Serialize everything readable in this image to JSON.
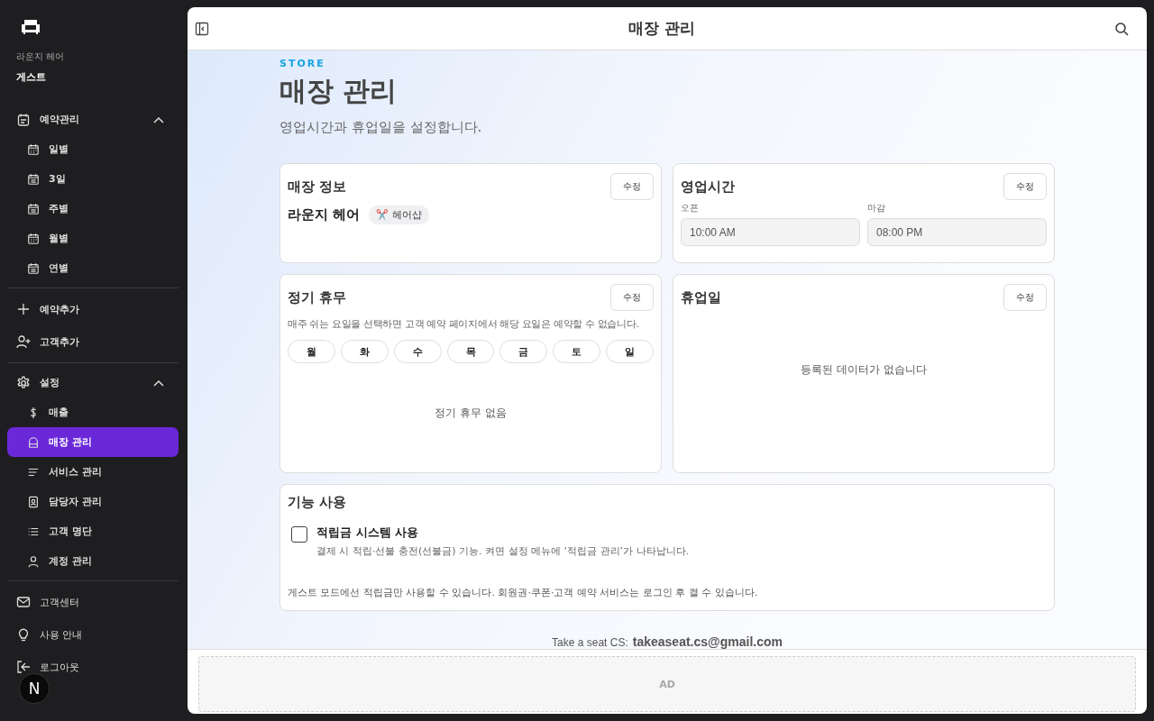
{
  "sidebar": {
    "store_name": "라운지 헤어",
    "user": "게스트",
    "sections": [
      {
        "items": [
          {
            "kind": "group",
            "label": "예약관리",
            "expanded": true,
            "children": [
              {
                "label": "일별",
                "selected": false
              },
              {
                "label": "3일",
                "selected": false
              },
              {
                "label": "주별",
                "selected": false
              },
              {
                "label": "월별",
                "selected": false
              },
              {
                "label": "연별",
                "selected": false
              }
            ]
          }
        ]
      },
      {
        "items": [
          {
            "kind": "link",
            "label": "예약추가"
          },
          {
            "kind": "link",
            "label": "고객추가"
          }
        ]
      },
      {
        "items": [
          {
            "kind": "group",
            "label": "설정",
            "expanded": true,
            "children": [
              {
                "label": "매출",
                "selected": false
              },
              {
                "label": "매장 관리",
                "selected": true
              },
              {
                "label": "서비스 관리",
                "selected": false
              },
              {
                "label": "담당자 관리",
                "selected": false
              },
              {
                "label": "고객 명단",
                "selected": false
              },
              {
                "label": "계정 관리",
                "selected": false
              }
            ]
          }
        ]
      },
      {
        "items": [
          {
            "kind": "link",
            "label": "고객센터"
          },
          {
            "kind": "link",
            "label": "사용 안내"
          },
          {
            "kind": "link",
            "label": "로그아웃"
          }
        ]
      }
    ],
    "badge": "N"
  },
  "header": {
    "title": "매장 관리"
  },
  "page": {
    "eyebrow": "STORE",
    "title": "매장 관리",
    "subtitle": "영업시간과 휴업일을 설정합니다."
  },
  "store_info": {
    "title": "매장 정보",
    "edit": "수정",
    "name": "라운지 헤어",
    "category": "✂️ 헤어샵"
  },
  "hours": {
    "title": "영업시간",
    "edit": "수정",
    "fields": [
      {
        "label": "오픈",
        "value": "10:00 AM"
      },
      {
        "label": "마감",
        "value": "08:00 PM"
      }
    ]
  },
  "regular_closure": {
    "title": "정기 휴무",
    "edit": "수정",
    "description": "매주 쉬는 요일을 선택하면 고객 예약 페이지에서 해당 요일은 예약할 수 없습니다.",
    "days": [
      {
        "label": "월",
        "selected": false
      },
      {
        "label": "화",
        "selected": false
      },
      {
        "label": "수",
        "selected": false
      },
      {
        "label": "목",
        "selected": false
      },
      {
        "label": "금",
        "selected": false
      },
      {
        "label": "토",
        "selected": false
      },
      {
        "label": "일",
        "selected": false
      }
    ],
    "empty": "정기 휴무 없음"
  },
  "holidays": {
    "title": "휴업일",
    "edit": "수정",
    "empty": "등록된 데이터가 없습니다"
  },
  "features": {
    "title": "기능 사용",
    "options": [
      {
        "label": "적립금 시스템 사용",
        "description": "결제 시 적립·선불 충전(선불금) 기능. 켜면 설정 메뉴에 ‘적립금 관리’가 나타납니다.",
        "checked": false
      }
    ],
    "note": "게스트 모드에선 적립금만 사용할 수 있습니다. 회원권·쿠폰·고객 예약 서비스는 로그인 후 켤 수 있습니다."
  },
  "footer": {
    "cs_label": "Take a seat CS:",
    "cs_email": "takeaseat.cs@gmail.com"
  },
  "ad": {
    "label": "AD"
  }
}
